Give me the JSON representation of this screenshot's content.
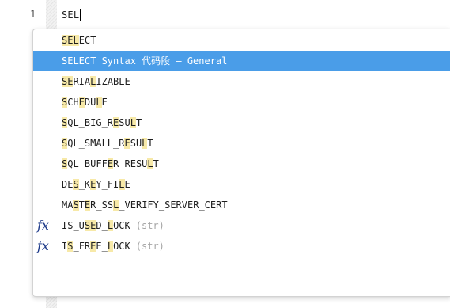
{
  "editor": {
    "line_number": "1",
    "code": "SEL"
  },
  "autocomplete": {
    "selected_index": 1,
    "items": [
      {
        "parts": [
          {
            "t": "SEL",
            "h": true
          },
          {
            "t": "ECT",
            "h": false
          }
        ],
        "args": "",
        "icon": ""
      },
      {
        "parts": [
          {
            "t": "SELECT Syntax 代码段 – General",
            "h": false
          }
        ],
        "args": "",
        "icon": ""
      },
      {
        "parts": [
          {
            "t": "SE",
            "h": true
          },
          {
            "t": "RIA",
            "h": false
          },
          {
            "t": "L",
            "h": true
          },
          {
            "t": "IZABLE",
            "h": false
          }
        ],
        "args": "",
        "icon": ""
      },
      {
        "parts": [
          {
            "t": "S",
            "h": true
          },
          {
            "t": "CH",
            "h": false
          },
          {
            "t": "E",
            "h": true
          },
          {
            "t": "DU",
            "h": false
          },
          {
            "t": "L",
            "h": true
          },
          {
            "t": "E",
            "h": false
          }
        ],
        "args": "",
        "icon": ""
      },
      {
        "parts": [
          {
            "t": "S",
            "h": true
          },
          {
            "t": "QL_BIG_R",
            "h": false
          },
          {
            "t": "E",
            "h": true
          },
          {
            "t": "SU",
            "h": false
          },
          {
            "t": "L",
            "h": true
          },
          {
            "t": "T",
            "h": false
          }
        ],
        "args": "",
        "icon": ""
      },
      {
        "parts": [
          {
            "t": "S",
            "h": true
          },
          {
            "t": "QL_SMALL_R",
            "h": false
          },
          {
            "t": "E",
            "h": true
          },
          {
            "t": "SU",
            "h": false
          },
          {
            "t": "L",
            "h": true
          },
          {
            "t": "T",
            "h": false
          }
        ],
        "args": "",
        "icon": ""
      },
      {
        "parts": [
          {
            "t": "S",
            "h": true
          },
          {
            "t": "QL_BUFF",
            "h": false
          },
          {
            "t": "E",
            "h": true
          },
          {
            "t": "R_RESU",
            "h": false
          },
          {
            "t": "L",
            "h": true
          },
          {
            "t": "T",
            "h": false
          }
        ],
        "args": "",
        "icon": ""
      },
      {
        "parts": [
          {
            "t": "DE",
            "h": false
          },
          {
            "t": "S",
            "h": true
          },
          {
            "t": "_K",
            "h": false
          },
          {
            "t": "E",
            "h": true
          },
          {
            "t": "Y_FI",
            "h": false
          },
          {
            "t": "L",
            "h": true
          },
          {
            "t": "E",
            "h": false
          }
        ],
        "args": "",
        "icon": ""
      },
      {
        "parts": [
          {
            "t": "MA",
            "h": false
          },
          {
            "t": "S",
            "h": true
          },
          {
            "t": "T",
            "h": false
          },
          {
            "t": "E",
            "h": true
          },
          {
            "t": "R_SS",
            "h": false
          },
          {
            "t": "L",
            "h": true
          },
          {
            "t": "_VERIFY_SERVER_CERT",
            "h": false
          }
        ],
        "args": "",
        "icon": ""
      },
      {
        "parts": [
          {
            "t": "IS_U",
            "h": false
          },
          {
            "t": "S",
            "h": true
          },
          {
            "t": "",
            "h": false
          },
          {
            "t": "E",
            "h": true
          },
          {
            "t": "D_",
            "h": false
          },
          {
            "t": "L",
            "h": true
          },
          {
            "t": "OCK",
            "h": false
          }
        ],
        "args": "(str)",
        "icon": "fx"
      },
      {
        "parts": [
          {
            "t": "I",
            "h": false
          },
          {
            "t": "S",
            "h": true
          },
          {
            "t": "_FR",
            "h": false
          },
          {
            "t": "E",
            "h": true
          },
          {
            "t": "E_",
            "h": false
          },
          {
            "t": "L",
            "h": true
          },
          {
            "t": "OCK",
            "h": false
          }
        ],
        "args": "(str)",
        "icon": "fx"
      }
    ]
  },
  "colors": {
    "selection": "#4a9de8",
    "match_highlight": "#f7e9a8",
    "function_icon": "#1d3a8a",
    "args_text": "#a6a6a6"
  }
}
